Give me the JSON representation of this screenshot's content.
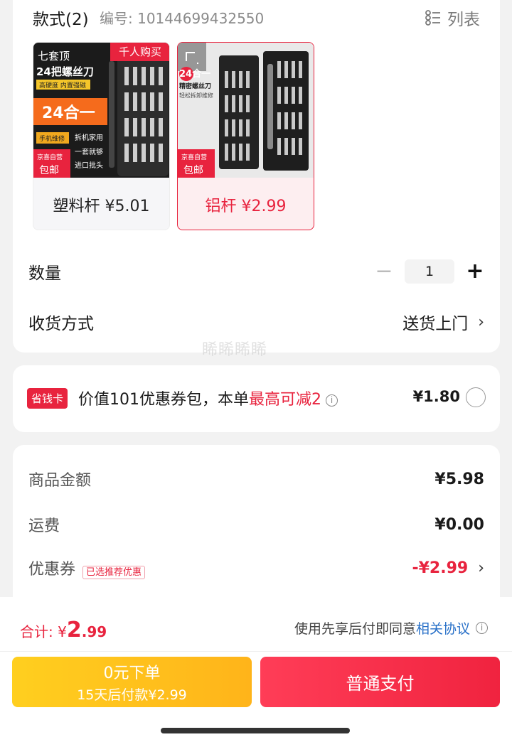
{
  "spec": {
    "title": "款式(2)",
    "sku": "编号: 10144699432550",
    "list_label": "列表",
    "variants": [
      {
        "label": "塑料杆 ¥5.01",
        "img_badge": "千人购买",
        "img_title1": "七套顶",
        "img_title2": "24把螺丝刀",
        "img_sub": "高硬度 内置强磁",
        "img_banner": "24合一",
        "img_tag1": "手机维修",
        "img_tag2": "拆机家用",
        "img_tag3": "一套就够",
        "img_tag4": "进口批头",
        "img_jd": "京喜自营",
        "img_free": "包邮"
      },
      {
        "label": "铝杆 ¥2.99",
        "img_title1": "24合一",
        "img_title2": "精密螺丝刀",
        "img_sub": "轻松拆卸维修",
        "img_jd": "京喜自营",
        "img_free": "包邮"
      }
    ]
  },
  "quantity": {
    "label": "数量",
    "minus": "−",
    "value": "1",
    "plus": "+"
  },
  "delivery": {
    "label": "收货方式",
    "value": "送货上门"
  },
  "watermark": "睎睎睎睎",
  "coupon": {
    "badge": "省钱卡",
    "text_before": "价值101优惠券包，本单",
    "text_highlight": "最高可减2",
    "price": "¥1.80"
  },
  "summary": {
    "goods_label": "商品金额",
    "goods_value": "¥5.98",
    "freight_label": "运费",
    "freight_value": "¥0.00",
    "discount_label": "优惠券",
    "discount_tag": "已选推荐优惠",
    "discount_value": "-¥2.99"
  },
  "bottom": {
    "total_label": "合计:",
    "total_currency": "¥",
    "total_int": "2",
    "total_dec": ".99",
    "agree_text": "使用先享后付即同意",
    "agree_link": "相关协议",
    "later_line1": "0元下单",
    "later_line2": "15天后付款¥2.99",
    "pay_label": "普通支付"
  },
  "colors": {
    "accent": "#e8233e",
    "link": "#2870c8",
    "later_button": "#ffc21c"
  }
}
